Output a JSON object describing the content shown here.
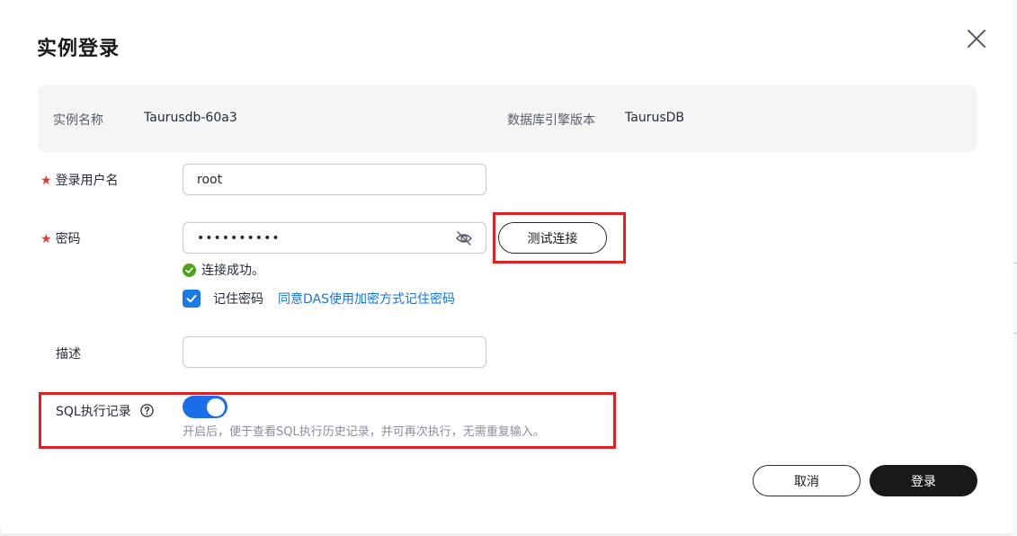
{
  "dialog": {
    "title": "实例登录",
    "close_icon": "close-icon"
  },
  "info": {
    "instance_name_label": "实例名称",
    "instance_name_value": "Taurusdb-60a3",
    "engine_version_label": "数据库引擎版本",
    "engine_version_value": "TaurusDB"
  },
  "form": {
    "required_mark": "★",
    "username_label": "登录用户名",
    "username_value": "root",
    "password_label": "密码",
    "password_value": "••••••••••",
    "test_connection_label": "测试连接",
    "success_message": "连接成功。",
    "remember_label": "记住密码",
    "remember_checked": true,
    "remember_link": "同意DAS使用加密方式记住密码",
    "description_label": "描述",
    "description_value": "",
    "sql_record_label": "SQL执行记录",
    "sql_record_enabled": true,
    "sql_record_hint": "开启后，便于查看SQL执行历史记录，并可再次执行，无需重复输入。"
  },
  "footer": {
    "cancel_label": "取消",
    "login_label": "登录"
  },
  "colors": {
    "primary": "#1a7ae8",
    "success": "#4aa319",
    "highlight_box": "#e02020",
    "link": "#1476d9"
  }
}
